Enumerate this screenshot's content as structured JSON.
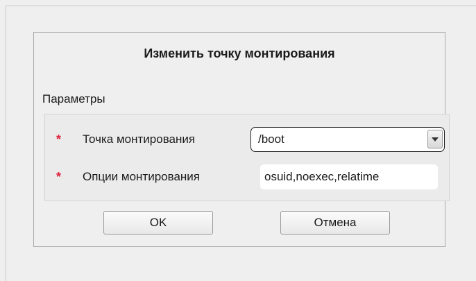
{
  "dialog": {
    "title": "Изменить точку монтирования",
    "section_label": "Параметры",
    "fields": {
      "mount_point": {
        "required_marker": "*",
        "label": "Точка монтирования",
        "value": "/boot"
      },
      "mount_options": {
        "required_marker": "*",
        "label": "Опции монтирования",
        "value": "osuid,noexec,relatime"
      }
    },
    "buttons": {
      "ok_label": "OK",
      "cancel_label": "Отмена"
    }
  },
  "icons": {
    "dropdown": "chevron-down-icon"
  },
  "colors": {
    "required_marker": "#e0203a"
  }
}
